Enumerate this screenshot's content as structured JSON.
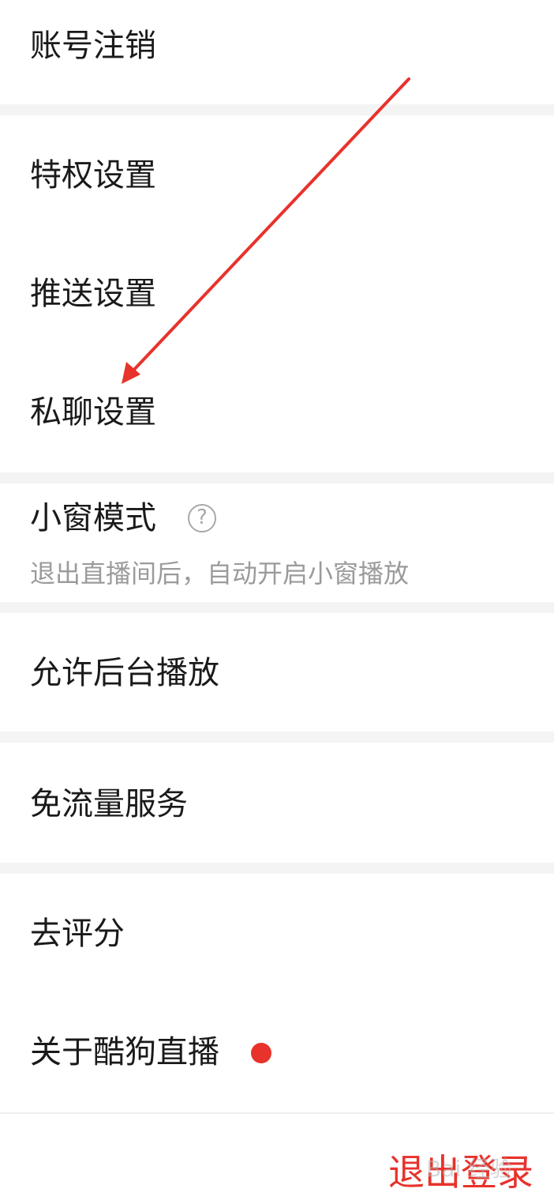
{
  "menu": {
    "account_cancel": "账号注销",
    "privilege": "特权设置",
    "push": "推送设置",
    "private_chat": "私聊设置",
    "mini_window": {
      "label": "小窗模式",
      "help_glyph": "?",
      "description": "退出直播间后，自动开启小窗播放"
    },
    "background_play": "允许后台播放",
    "free_data": "免流量服务",
    "rate": "去评分",
    "about": "关于酷狗直播"
  },
  "logout_label": "退出登录",
  "watermark_text": "Bai 经验",
  "colors": {
    "accent": "#e8322c",
    "annotation_arrow": "#e8322c",
    "section_gap": "#f4f4f4"
  },
  "icons": {
    "help": "question-circle-icon",
    "notification": "red-dot-badge"
  }
}
